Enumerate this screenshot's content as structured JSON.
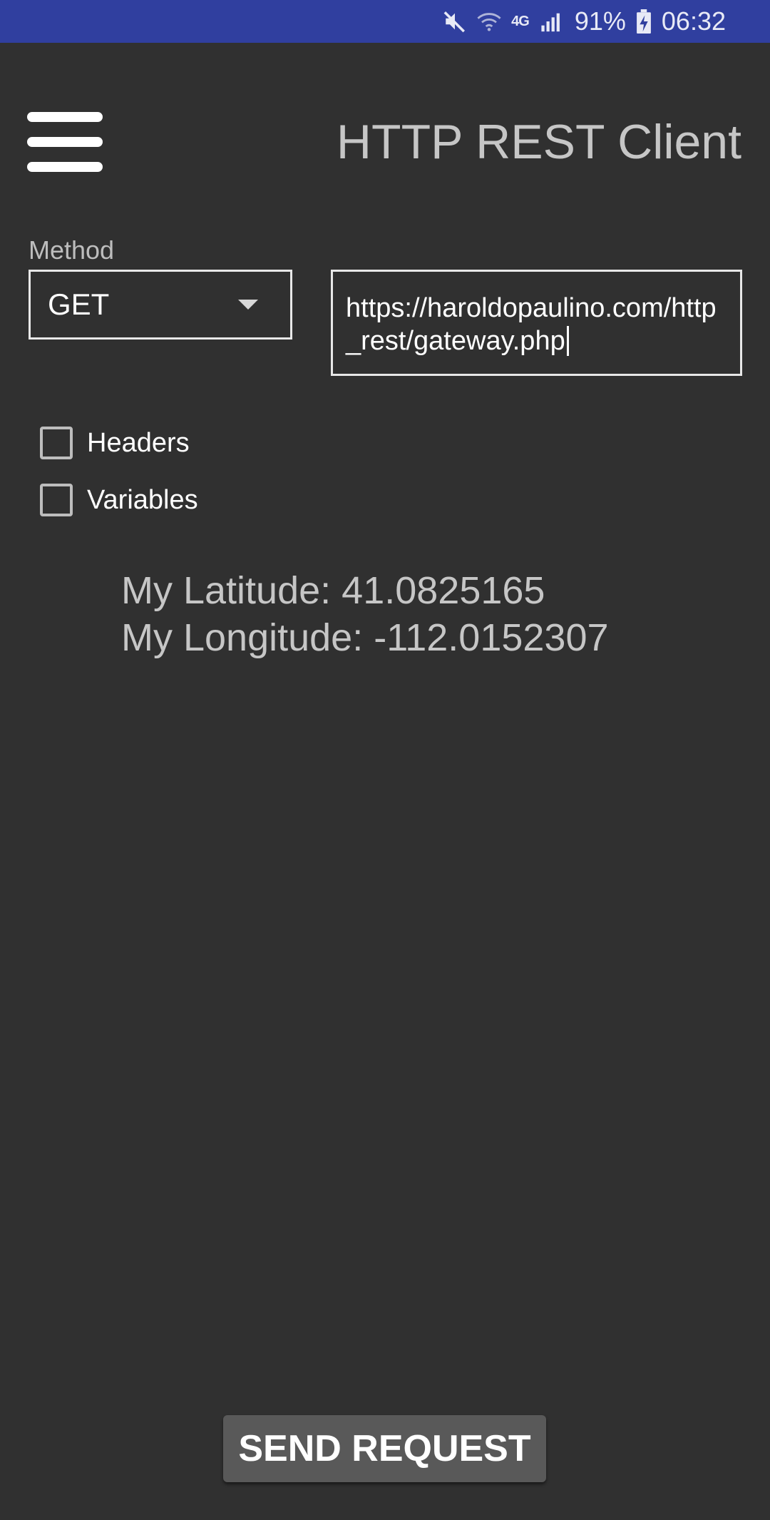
{
  "status_bar": {
    "battery_percent": "91%",
    "time": "06:32",
    "network_type": "4G",
    "icons": [
      "mute-icon",
      "wifi-icon",
      "signal-icon",
      "battery-charging-icon"
    ]
  },
  "app_bar": {
    "title": "HTTP REST Client",
    "menu_icon": "hamburger-menu-icon"
  },
  "form": {
    "method_label": "Method",
    "method_value": "GET",
    "url_value": "https://haroldopaulino.com/http_rest/gateway.php",
    "options": [
      {
        "label": "Headers",
        "checked": false
      },
      {
        "label": "Variables",
        "checked": false
      }
    ]
  },
  "location": {
    "latitude_text": "My Latitude: 41.0825165",
    "longitude_text": "My Longitude: -112.0152307"
  },
  "actions": {
    "send_label": "SEND REQUEST"
  },
  "colors": {
    "status_bar": "#303f9f",
    "background": "#303030",
    "button": "#595959"
  }
}
